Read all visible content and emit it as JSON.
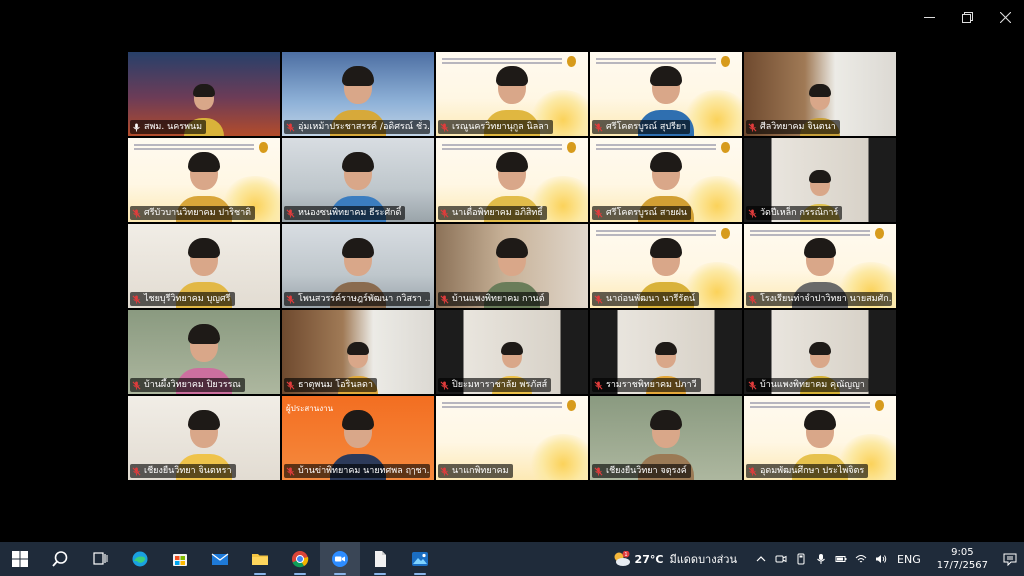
{
  "window": {
    "controls": [
      "minimize-icon",
      "restore-icon",
      "close-icon"
    ]
  },
  "participants": [
    {
      "name": "สพม. นครพนม",
      "bg": "stage",
      "active": true,
      "muted": false
    },
    {
      "name": "อุ่มเหม้าประชาสรรค์ /อดิศรณ์ ชั่ว...",
      "bg": "blue",
      "muted": true
    },
    {
      "name": "เรณูนครวิทยานุกูล นิลลา",
      "bg": "banner",
      "muted": true
    },
    {
      "name": "ศรีโคตรบูรณ์ สุปรียา",
      "bg": "banner",
      "muted": true
    },
    {
      "name": "ศีลวิทยาคม จินตนา",
      "bg": "shelf",
      "muted": true
    },
    {
      "name": "ศรีบัวบานวิทยาคม ปาริชาติ",
      "bg": "banner",
      "muted": true
    },
    {
      "name": "หนองซนพิทยาคม ธีระศักดิ์",
      "bg": "room",
      "muted": true
    },
    {
      "name": "นาเดื่อพิทยาคม อภิสิทธิ์",
      "bg": "banner",
      "muted": true
    },
    {
      "name": "ศรีโคตรบูรณ์ สายฝน",
      "bg": "banner",
      "muted": true
    },
    {
      "name": "วัดปีเหล็ก กรรณิการ์",
      "bg": "pillar",
      "muted": true
    },
    {
      "name": "ไชยบุรีวิทยาคม บุญศรี",
      "bg": "wall",
      "muted": true
    },
    {
      "name": "โพนสวรรค์ราษฎร์พัฒนา กวิสรา ...",
      "bg": "room",
      "muted": true
    },
    {
      "name": "บ้านแพงพิทยาคม กานต์",
      "bg": "office",
      "muted": true
    },
    {
      "name": "นาถ่อนพัฒนา นารีรัตน์",
      "bg": "banner",
      "muted": true
    },
    {
      "name": "โรงเรียนท่าจำปาวิทยา นายสมศัก...",
      "bg": "banner",
      "muted": true
    },
    {
      "name": "บ้านผึ้งวิทยาคม ปิยวรรณ",
      "bg": "green",
      "muted": true
    },
    {
      "name": "ธาตุพนม โอรินลดา",
      "bg": "shelf",
      "muted": true
    },
    {
      "name": "ปิยะมหาราชาลัย พรภัสส์",
      "bg": "pillar",
      "muted": true
    },
    {
      "name": "รามราชพิทยาคม ปภาวี",
      "bg": "pillar",
      "muted": true
    },
    {
      "name": "บ้านแพงพิทยาคม คุณัญญา",
      "bg": "pillar",
      "muted": true
    },
    {
      "name": "เชียงยืนวิทยา จินตหรา",
      "bg": "wall",
      "muted": true
    },
    {
      "name": "บ้านข่าพิทยาคม นายทศพล ฤๅชา...",
      "bg": "orange",
      "muted": true,
      "slide_title": "ผู้ประสานงาน"
    },
    {
      "name": "นาแกพิทยาคม",
      "bg": "banner",
      "muted": true,
      "no_video": true
    },
    {
      "name": "เชียงยืนวิทยา จตุรงค์",
      "bg": "green",
      "muted": true
    },
    {
      "name": "อุดมพัฒนศึกษา ประไพจิตร",
      "bg": "banner",
      "muted": true
    }
  ],
  "taskbar": {
    "apps": [
      {
        "icon": "windows-start-icon",
        "focused": false,
        "running": false
      },
      {
        "icon": "search-icon",
        "focused": false,
        "running": false
      },
      {
        "icon": "task-view-icon",
        "focused": false,
        "running": false
      },
      {
        "icon": "edge-browser-icon",
        "focused": false,
        "running": false
      },
      {
        "icon": "microsoft-store-icon",
        "focused": false,
        "running": false
      },
      {
        "icon": "mail-icon",
        "focused": false,
        "running": false
      },
      {
        "icon": "file-explorer-icon",
        "focused": false,
        "running": true
      },
      {
        "icon": "chrome-icon",
        "focused": false,
        "running": true
      },
      {
        "icon": "zoom-icon",
        "focused": true,
        "running": true
      },
      {
        "icon": "document-icon",
        "focused": false,
        "running": true
      },
      {
        "icon": "photos-icon",
        "focused": false,
        "running": true
      }
    ],
    "weather": {
      "temp": "27°C",
      "condition": "มีแดดบางส่วน",
      "badge": "1"
    },
    "language": "ENG",
    "time": "9:05",
    "date": "17/7/2567"
  },
  "colors": {
    "active_border": "#2ecc40",
    "muted_mic": "#e23c3c",
    "taskbar_bg": "#1f2b3a"
  }
}
